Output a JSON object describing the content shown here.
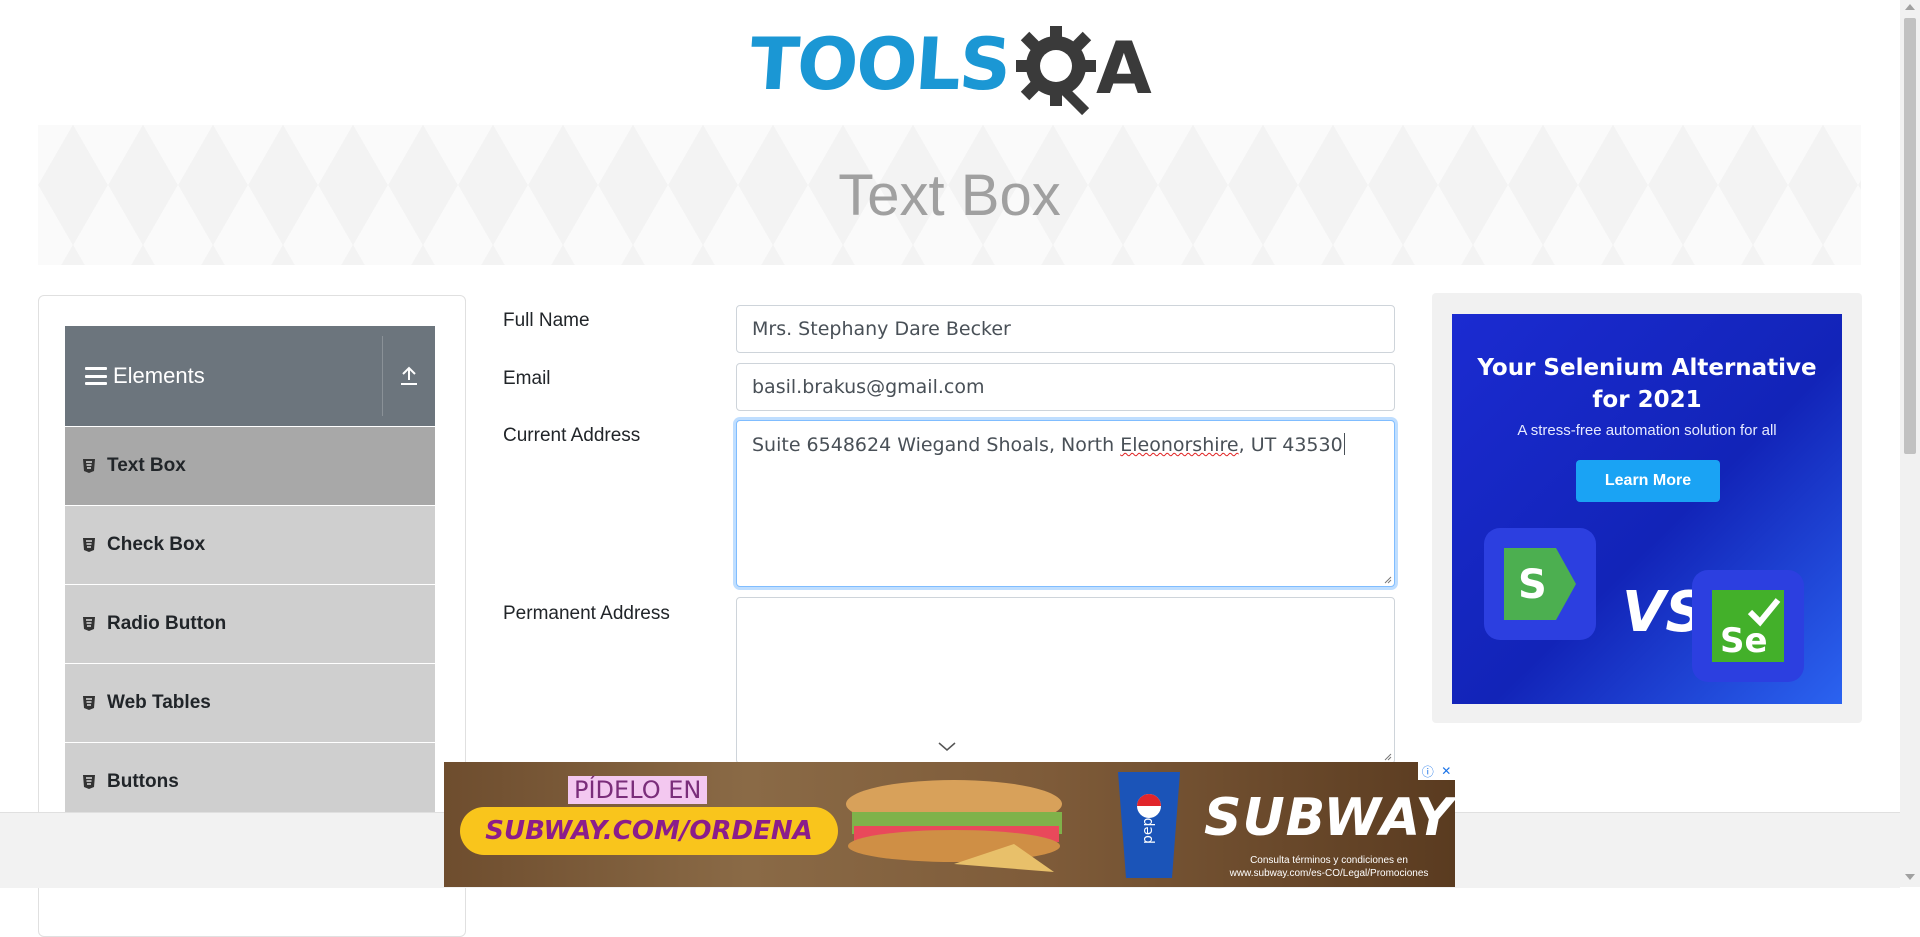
{
  "header": {
    "logo_text": "TOOLS",
    "logo_text_tail": "A"
  },
  "banner": {
    "title": "Text Box"
  },
  "sidebar": {
    "group_title": "Elements",
    "items": [
      {
        "label": "Text Box",
        "active": true
      },
      {
        "label": "Check Box"
      },
      {
        "label": "Radio Button"
      },
      {
        "label": "Web Tables"
      },
      {
        "label": "Buttons"
      }
    ]
  },
  "form": {
    "full_name": {
      "label": "Full Name",
      "value": "Mrs. Stephany Dare Becker"
    },
    "email": {
      "label": "Email",
      "value": "basil.brakus@gmail.com"
    },
    "current_address": {
      "label": "Current Address",
      "value_before": "Suite 6548624 Wiegand Shoals, North ",
      "value_misspelled": "Eleonorshire",
      "value_after": ", UT 43530"
    },
    "permanent_address": {
      "label": "Permanent Address",
      "value": ""
    }
  },
  "right_ad": {
    "title_line1": "Your Selenium Alternative",
    "title_line2": "for 2021",
    "subtitle": "A stress-free automation solution for all",
    "button": "Learn More",
    "vs": "VS",
    "logo_left": "S",
    "logo_right": "Se"
  },
  "bottom_ad": {
    "pidelo": "PÍDELO EN",
    "url": "SUBWAY.COM/ORDENA",
    "brand": "SUBWAY",
    "legal_line1": "Consulta términos y condiciones en",
    "legal_line2": "www.subway.com/es-CO/Legal/Promociones",
    "cup_text": "pepsi"
  },
  "colors": {
    "brand_blue": "#1b97d4",
    "sidebar_header": "#6c757d",
    "menu_item": "#cfcfcf",
    "menu_item_active": "#a8a8a8",
    "focus_border": "#80bdff"
  }
}
